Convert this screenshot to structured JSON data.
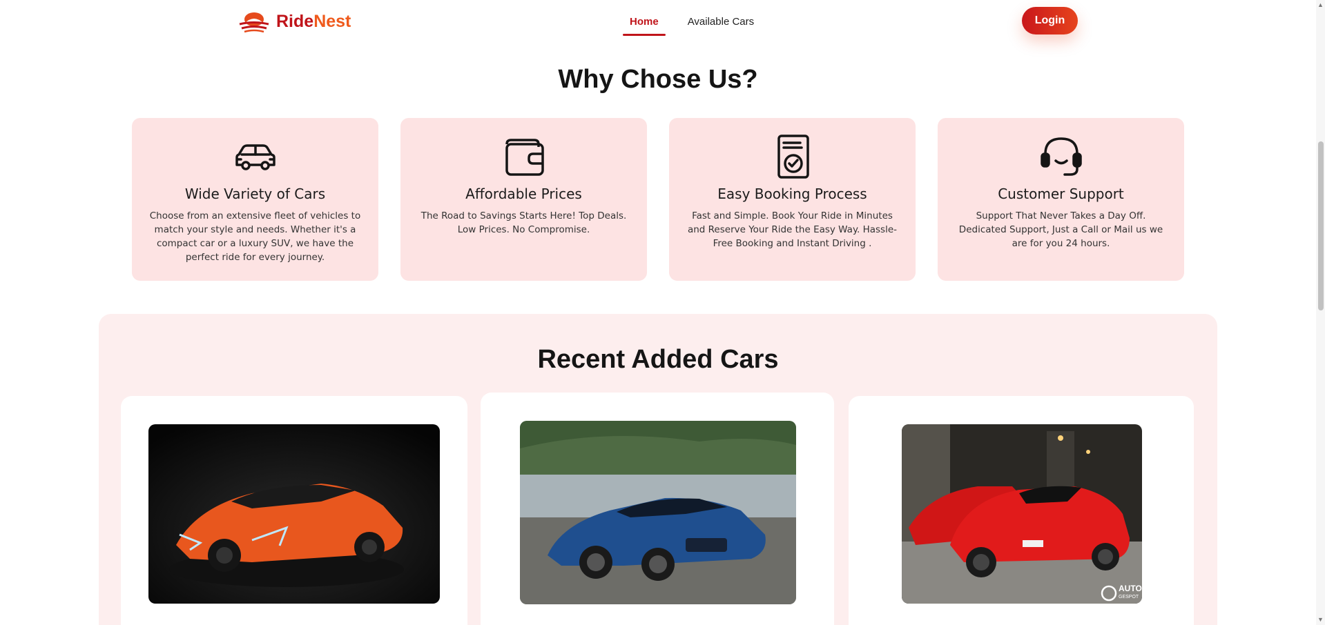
{
  "brand": {
    "part1": "Ride",
    "part2": "Nest"
  },
  "nav": {
    "items": [
      {
        "label": "Home",
        "active": true
      },
      {
        "label": "Available Cars",
        "active": false
      }
    ],
    "login_label": "Login"
  },
  "why": {
    "title": "Why Chose Us?",
    "cards": [
      {
        "icon": "car-icon",
        "title": "Wide Variety of Cars",
        "desc": "Choose from an extensive fleet of vehicles to match your style and needs. Whether it's a compact car or a luxury SUV, we have the perfect ride for every journey."
      },
      {
        "icon": "wallet-icon",
        "title": "Affordable Prices",
        "desc": "The Road to Savings Starts Here! Top Deals. Low Prices. No Compromise."
      },
      {
        "icon": "document-check-icon",
        "title": "Easy Booking Process",
        "desc": "Fast and Simple. Book Your Ride in Minutes and Reserve Your Ride the Easy Way. Hassle-Free Booking and Instant Driving ."
      },
      {
        "icon": "headset-icon",
        "title": "Customer Support",
        "desc": "Support That Never Takes a Day Off. Dedicated Support, Just a Call or Mail us we are for you 24 hours."
      }
    ]
  },
  "recent": {
    "title": "Recent Added Cars",
    "cars": [
      {
        "image": "orange-supercar-photo"
      },
      {
        "image": "blue-sedan-photo"
      },
      {
        "image": "red-ferrari-photo",
        "watermark": "AUTO GESPOT"
      }
    ]
  },
  "colors": {
    "accent": "#c0141a",
    "accent_orange": "#ef5a1c",
    "card_bg": "#fde3e3",
    "section_bg": "#fdeeee"
  }
}
